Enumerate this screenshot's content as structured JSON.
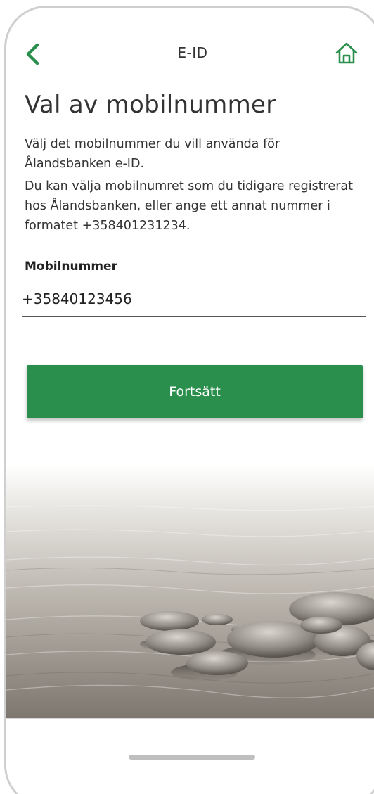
{
  "header": {
    "title": "E-ID",
    "back_icon": "chevron-left-icon",
    "home_icon": "home-icon"
  },
  "main": {
    "title": "Val av mobilnummer",
    "description_1": "Välj det mobilnummer du vill använda för Ålandsbanken e-ID.",
    "description_2": "Du kan välja mobilnumret som du tidigare registrerat hos Ålandsbanken, eller ange ett annat nummer i formatet +358401231234.",
    "phone_label": "Mobilnummer",
    "phone_value": "+35840123456",
    "continue_label": "Fortsätt"
  },
  "colors": {
    "accent": "#2a8f4c",
    "text": "#333333"
  }
}
